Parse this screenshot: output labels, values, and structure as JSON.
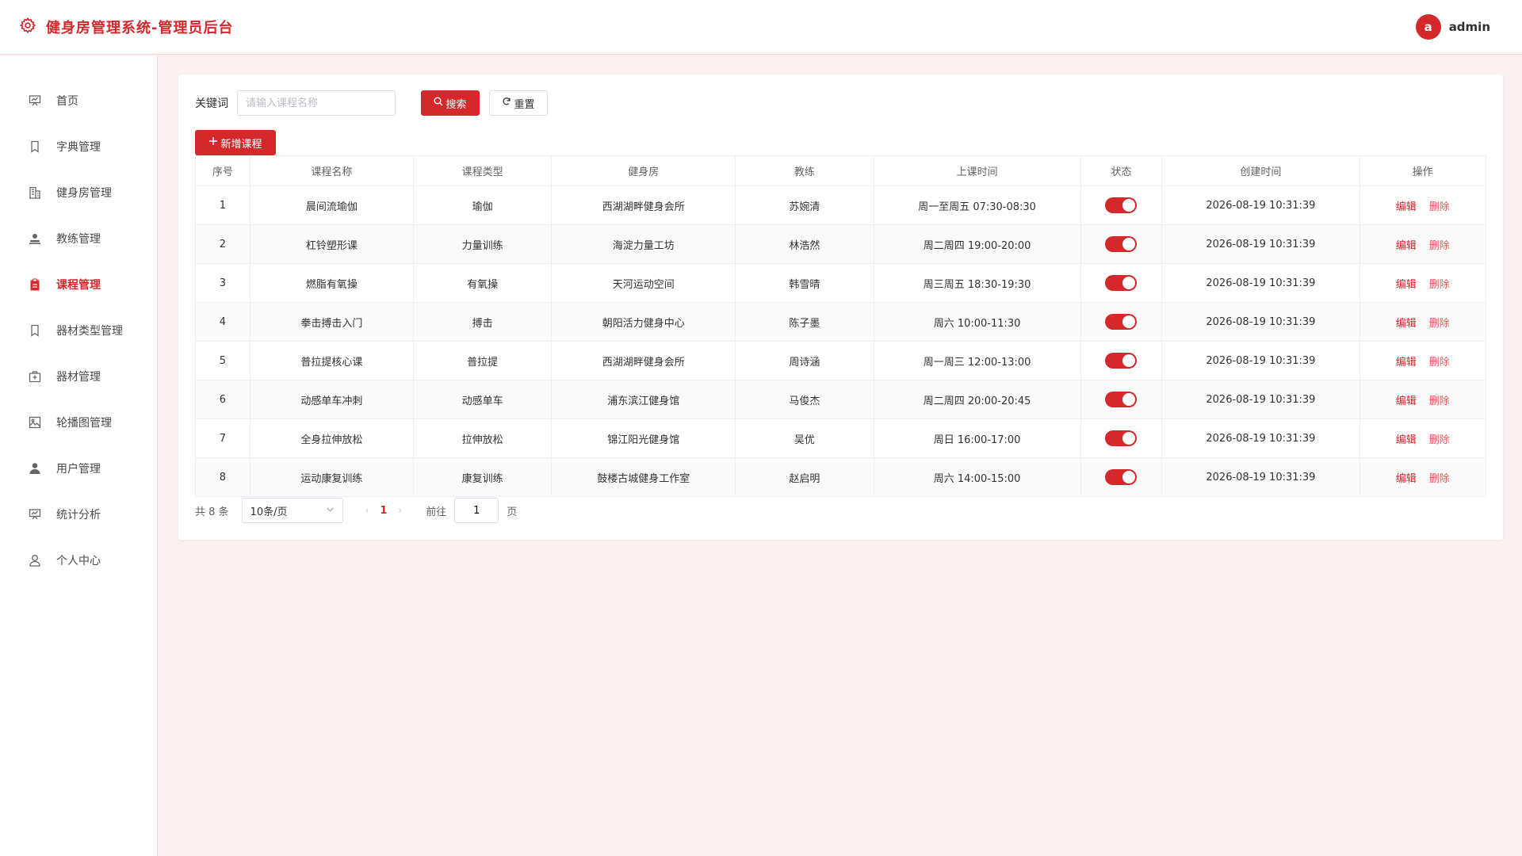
{
  "header": {
    "title": "健身房管理系统-管理员后台",
    "avatar_letter": "a",
    "username": "admin"
  },
  "sidebar": {
    "items": [
      {
        "label": "首页",
        "icon": "presentation-icon"
      },
      {
        "label": "字典管理",
        "icon": "bookmark-icon"
      },
      {
        "label": "健身房管理",
        "icon": "office-building-icon"
      },
      {
        "label": "教练管理",
        "icon": "person-stamp-icon"
      },
      {
        "label": "课程管理",
        "icon": "clipboard-icon",
        "active": true
      },
      {
        "label": "器材类型管理",
        "icon": "bookmark-icon"
      },
      {
        "label": "器材管理",
        "icon": "first-aid-kit-icon"
      },
      {
        "label": "轮播图管理",
        "icon": "picture-icon"
      },
      {
        "label": "用户管理",
        "icon": "user-filled-icon"
      },
      {
        "label": "统计分析",
        "icon": "presentation-icon"
      },
      {
        "label": "个人中心",
        "icon": "user-outline-icon"
      }
    ]
  },
  "search": {
    "label": "关键词",
    "placeholder": "请输入课程名称",
    "search_label": "搜索",
    "reset_label": "重置"
  },
  "add_label": "新增课程",
  "table": {
    "headers": [
      "序号",
      "课程名称",
      "课程类型",
      "健身房",
      "教练",
      "上课时间",
      "状态",
      "创建时间",
      "操作"
    ],
    "rows": [
      {
        "no": "1",
        "name": "晨间流瑜伽",
        "type": "瑜伽",
        "gym": "西湖湖畔健身会所",
        "coach": "苏婉清",
        "time": "周一至周五 07:30-08:30",
        "status": true,
        "created": "2026-08-19 10:31:39"
      },
      {
        "no": "2",
        "name": "杠铃塑形课",
        "type": "力量训练",
        "gym": "海淀力量工坊",
        "coach": "林浩然",
        "time": "周二周四 19:00-20:00",
        "status": true,
        "created": "2026-08-19 10:31:39"
      },
      {
        "no": "3",
        "name": "燃脂有氧操",
        "type": "有氧操",
        "gym": "天河运动空间",
        "coach": "韩雪晴",
        "time": "周三周五 18:30-19:30",
        "status": true,
        "created": "2026-08-19 10:31:39"
      },
      {
        "no": "4",
        "name": "拳击搏击入门",
        "type": "搏击",
        "gym": "朝阳活力健身中心",
        "coach": "陈子墨",
        "time": "周六 10:00-11:30",
        "status": true,
        "created": "2026-08-19 10:31:39"
      },
      {
        "no": "5",
        "name": "普拉提核心课",
        "type": "普拉提",
        "gym": "西湖湖畔健身会所",
        "coach": "周诗涵",
        "time": "周一周三 12:00-13:00",
        "status": true,
        "created": "2026-08-19 10:31:39"
      },
      {
        "no": "6",
        "name": "动感单车冲刺",
        "type": "动感单车",
        "gym": "浦东滨江健身馆",
        "coach": "马俊杰",
        "time": "周二周四 20:00-20:45",
        "status": true,
        "created": "2026-08-19 10:31:39"
      },
      {
        "no": "7",
        "name": "全身拉伸放松",
        "type": "拉伸放松",
        "gym": "锦江阳光健身馆",
        "coach": "吴优",
        "time": "周日 16:00-17:00",
        "status": true,
        "created": "2026-08-19 10:31:39"
      },
      {
        "no": "8",
        "name": "运动康复训练",
        "type": "康复训练",
        "gym": "鼓楼古城健身工作室",
        "coach": "赵启明",
        "time": "周六 14:00-15:00",
        "status": true,
        "created": "2026-08-19 10:31:39"
      }
    ],
    "edit_label": "编辑",
    "delete_label": "删除"
  },
  "pagination": {
    "total_text": "共 8 条",
    "page_size": "10条/页",
    "current_page": "1",
    "goto_label": "前往",
    "goto_value": "1",
    "page_suffix": "页"
  },
  "colors": {
    "accent": "#d4282c",
    "background": "#fdf0f0"
  }
}
